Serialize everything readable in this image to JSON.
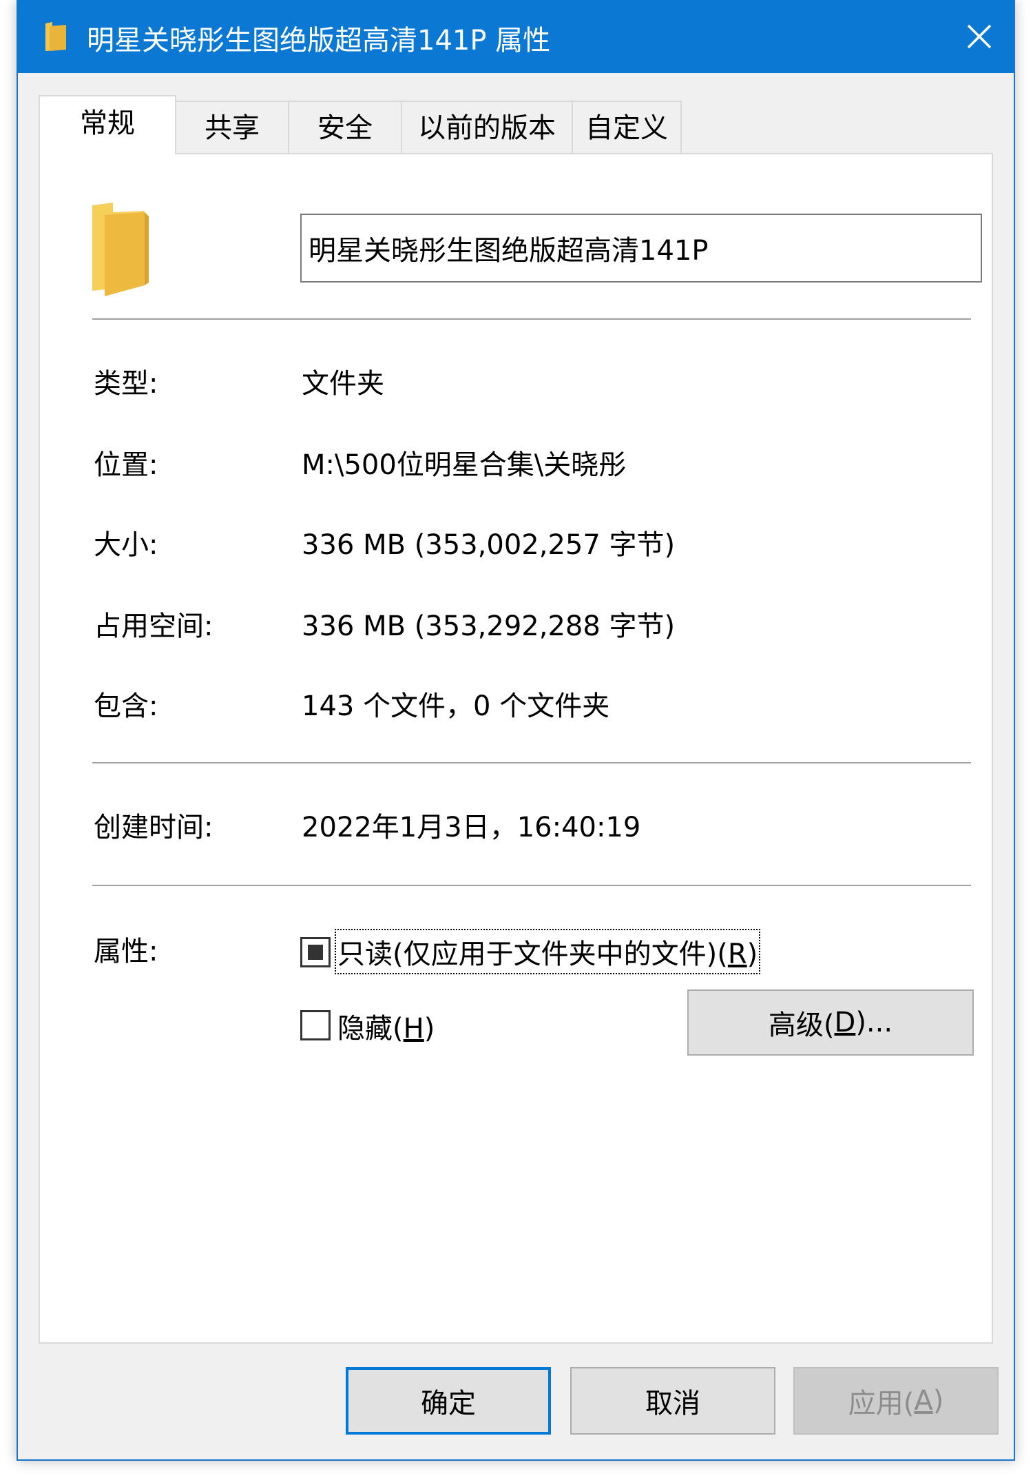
{
  "window": {
    "title": "明星关晓彤生图绝版超高清141P 属性",
    "accent": "#0b78d4"
  },
  "tabs": [
    {
      "label": "常规",
      "active": true
    },
    {
      "label": "共享",
      "active": false
    },
    {
      "label": "安全",
      "active": false
    },
    {
      "label": "以前的版本",
      "active": false
    },
    {
      "label": "自定义",
      "active": false
    }
  ],
  "general": {
    "name_value": "明星关晓彤生图绝版超高清141P",
    "rows": [
      {
        "label": "类型:",
        "value": "文件夹"
      },
      {
        "label": "位置:",
        "value": "M:\\500位明星合集\\关晓彤"
      },
      {
        "label": "大小:",
        "value": "336 MB (353,002,257 字节)"
      },
      {
        "label": "占用空间:",
        "value": "336 MB (353,292,288 字节)"
      },
      {
        "label": "包含:",
        "value": "143 个文件，0 个文件夹"
      }
    ],
    "created_label": "创建时间:",
    "created_value": "2022年1月3日，16:40:19",
    "attributes_label": "属性:",
    "readonly_label": "只读(仅应用于文件夹中的文件)(",
    "readonly_key": "R",
    "readonly_suffix": ")",
    "hidden_label": "隐藏(",
    "hidden_key": "H",
    "hidden_suffix": ")",
    "advanced_label": "高级(",
    "advanced_key": "D",
    "advanced_suffix": ")..."
  },
  "footer": {
    "ok_label": "确定",
    "cancel_label": "取消",
    "apply_label": "应用(",
    "apply_key": "A",
    "apply_suffix": ")"
  },
  "icons": {
    "title_icon": "folder-icon",
    "close_icon": "close-icon",
    "big_icon": "folder-icon"
  }
}
